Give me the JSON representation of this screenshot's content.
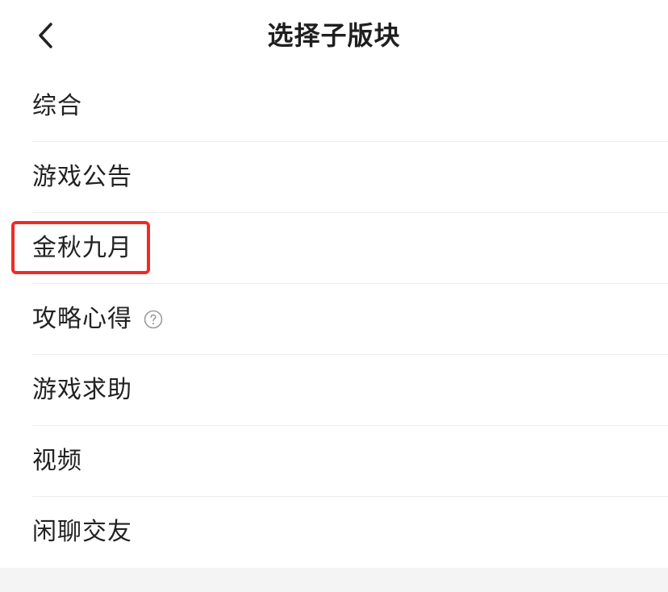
{
  "header": {
    "title": "选择子版块"
  },
  "icons": {
    "back": "chevron-left-icon",
    "help": "question-circle-icon"
  },
  "colors": {
    "highlight": "#f22a24",
    "divider": "#ececec",
    "footer_bg": "#f4f4f4",
    "text": "#222222"
  },
  "list": {
    "items": [
      {
        "label": "综合"
      },
      {
        "label": "游戏公告"
      },
      {
        "label": "金秋九月"
      },
      {
        "label": "攻略心得"
      },
      {
        "label": "游戏求助"
      },
      {
        "label": "视频"
      },
      {
        "label": "闲聊交友"
      }
    ]
  }
}
